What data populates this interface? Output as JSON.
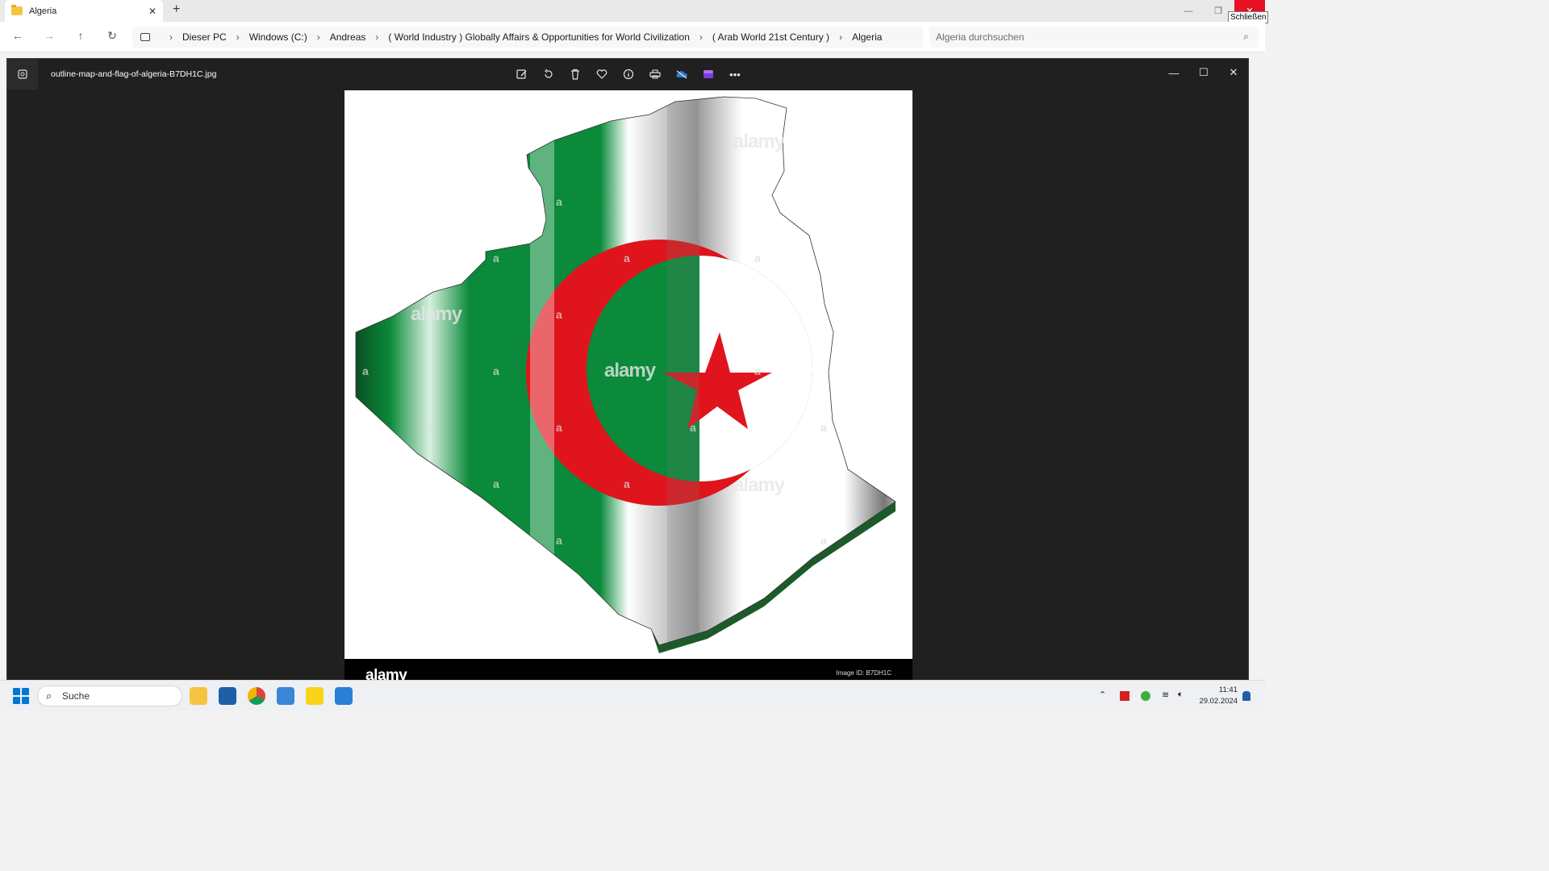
{
  "explorer": {
    "tab_title": "Algeria",
    "new_tab": "+",
    "close_tooltip": "Schließen",
    "breadcrumbs": [
      "Dieser PC",
      "Windows (C:)",
      "Andreas",
      "( World Industry ) Globally Affairs & Opportunities for World Civilization",
      "( Arab World 21st Century )",
      "Algeria"
    ],
    "search_placeholder": "Algeria durchsuchen"
  },
  "viewer": {
    "filename": "outline-map-and-flag-of-algeria-B7DH1C.jpg",
    "toolbar_icons": [
      "edit-icon",
      "rotate-icon",
      "delete-icon",
      "favorite-icon",
      "info-icon",
      "print-icon",
      "onedrive-icon",
      "clipchamp-icon",
      "more-icon"
    ]
  },
  "image": {
    "footer_logo": "alamy",
    "image_id": "Image ID: B7DH1C",
    "watermark_small": "a",
    "watermark_big": "alamy",
    "flag_colors": {
      "green": "#0a8a3a",
      "white": "#ffffff",
      "red": "#e0141c"
    }
  },
  "taskbar": {
    "search_label": "Suche",
    "time": "11:41",
    "date": "29.02.2024"
  }
}
